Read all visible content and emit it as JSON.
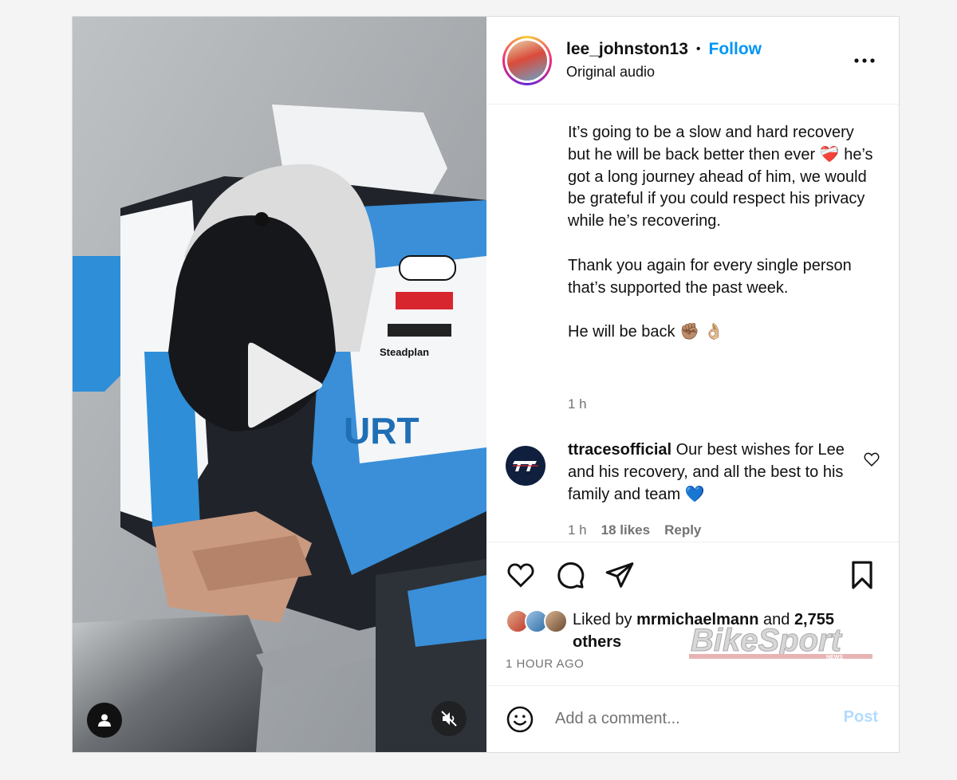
{
  "post": {
    "username": "lee_johnston13",
    "separator": "•",
    "follow_label": "Follow",
    "audio_label": "Original audio",
    "more_icon": "more-horizontal-icon",
    "caption": {
      "paragraph1": "It’s going to be a slow and hard recovery but he will be back better then ever ❤️‍🩹 he’s got a long journey ahead of him, we would be grateful if you could respect his privacy while he’s recovering.",
      "paragraph2": "Thank you again for every single person that’s supported the past week.",
      "paragraph3": "He will be back ✊🏽 👌🏼",
      "time": "1 h"
    },
    "comment": {
      "username": "ttracesofficial",
      "avatar_label": "TT",
      "text": " Our best wishes for Lee and his recovery, and all the best to his family and team 💙",
      "time": "1 h",
      "likes": "18 likes",
      "reply_label": "Reply"
    },
    "likes": {
      "liked_by_prefix": "Liked by ",
      "liked_by_user": "mrmichaelmann",
      "and_label": " and ",
      "others_count": "2,755 others"
    },
    "time_ago": "1 HOUR AGO",
    "watermark_text": "BikeSport",
    "watermark_sub": "NEWS",
    "add_comment": {
      "placeholder": "Add a comment...",
      "post_label": "Post"
    }
  },
  "colors": {
    "follow": "#0095f6",
    "post_disabled": "#b3dbff",
    "meta_grey": "#737373",
    "tt_navy": "#0f1f3d"
  }
}
